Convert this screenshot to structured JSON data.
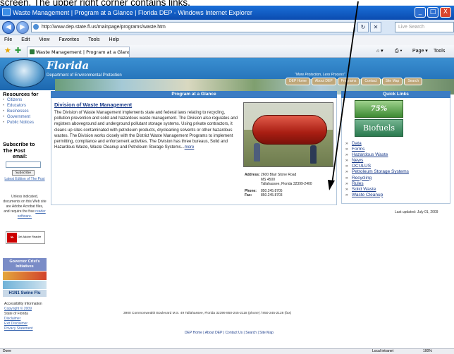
{
  "overlay_text": "screen.  The upper right corner contains links.",
  "window": {
    "title": "Waste Management | Program at a Glance | Florida DEP - Windows Internet Explorer",
    "minimize": "_",
    "maximize": "□",
    "close": "X"
  },
  "address": {
    "url": "http://www.dep.state.fl.us/mainpage/programs/waste.htm",
    "search_placeholder": "Live Search"
  },
  "menu": [
    "File",
    "Edit",
    "View",
    "Favorites",
    "Tools",
    "Help"
  ],
  "tab": {
    "label": "Waste Management | Program at a Glance | Florida DEP"
  },
  "toolbar": {
    "page": "Page",
    "tools": "Tools"
  },
  "header": {
    "brand": "Florida",
    "subtitle": "Department of Environmental Protection",
    "tagline": "\"More Protection, Less Process\"",
    "nav": [
      "DEP Home",
      "About DEP",
      "Programs",
      "Contact",
      "Site Map",
      "Search"
    ]
  },
  "left": {
    "resources_title": "Resources for",
    "resources": [
      "Citizens",
      "Educators",
      "Businesses",
      "Government",
      "Public Notices"
    ],
    "subscribe_title": "Subscribe to The Post",
    "email_label": "email:",
    "subscribe_button": "Subscribe",
    "latest_edition": "Latest Edition of The Post",
    "pdf_note_plain": "Unless indicated, documents on this Web site are Adobe Acrobat files, and require the free",
    "pdf_note_link": "reader software.",
    "adobe_label": "Get Adobe Reader",
    "governor_box": "Governor Crist's Initiatives",
    "h1n1": "H1N1 Swine Flu",
    "accessibility": "Accessibility Information",
    "copyright": "Copyright © 2009",
    "state": "State of Florida",
    "disclaimer": "Disclaimer",
    "exit_disclaimer": "Exit Disclaimer",
    "privacy": "Privacy Statement"
  },
  "center": {
    "header": "Program at a Glance",
    "division_title": "Division of Waste Management",
    "description": "The Division of Waste Management implements state and federal laws relating to recycling, pollution prevention and solid and hazardous waste management. The Division also regulates and registers aboveground and underground pollutant storage systems. Using private contractors, it cleans up sites contaminated with petroleum products, drycleaning solvents or other hazardous wastes. The Division works closely with the District Waste Management Programs to implement permitting, compliance and enforcement activities. The Division has three bureaus, Solid and Hazardous Waste, Waste Cleanup and Petroleum Storage Systems...",
    "more_link": "more",
    "address_label": "Address:",
    "address_lines": [
      "2600 Blair Stone Road",
      "MS 4500",
      "Tallahassee, Florida 32399-2400"
    ],
    "phone_label": "Phone:",
    "phone": "850.245.8705",
    "fax_label": "Fax:",
    "fax": "850.245.8703"
  },
  "quick_links": {
    "header": "Quick Links",
    "recycling_banner": "75% Recycling",
    "biofuels_banner": "Biofuels",
    "items": [
      "Data",
      "Forms",
      "Hazardous Waste",
      "News",
      "OCULUS",
      "Petroleum Storage Systems",
      "Recycling",
      "Rules",
      "Solid Waste",
      "Waste Cleanup"
    ]
  },
  "last_updated": "Last updated: July 01, 2009",
  "footer": {
    "address": "3900 Commonwealth Boulevard M.S. 49   Tallahassee, Florida 32399   850-245-2118 (phone) / 850-245-2128 (fax)",
    "links": "DEP Home | About DEP | Contact Us | Search | Site Map"
  },
  "status": {
    "left": "Done",
    "zone": "Local intranet",
    "zoom": "100%"
  },
  "colors": {
    "accent": "#3b7cc3",
    "titlebar": "#0b4cb0",
    "link": "#1a3b8a"
  }
}
